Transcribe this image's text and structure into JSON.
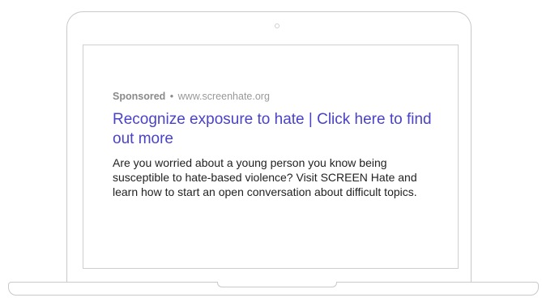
{
  "ad": {
    "sponsored_label": "Sponsored",
    "separator": "•",
    "display_url": "www.screenhate.org",
    "headline": "Recognize exposure to hate | Click here to find out more",
    "description": "Are you worried about a young person you know being susceptible to hate-based violence? Visit SCREEN Hate and learn how to start an open conversation about difficult topics."
  },
  "colors": {
    "headline": "#4a42c8",
    "body_text": "#222222",
    "meta_text": "#999999",
    "device_outline": "#c9c9c9"
  },
  "icons": {
    "camera": "camera-icon"
  }
}
